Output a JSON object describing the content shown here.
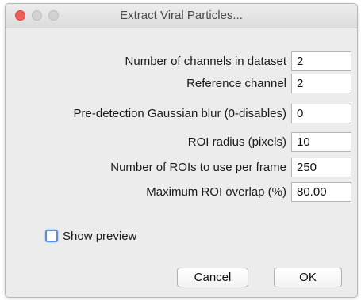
{
  "window": {
    "title": "Extract Viral Particles..."
  },
  "fields": [
    {
      "label": "Number of channels in dataset",
      "value": "2"
    },
    {
      "label": "Reference channel",
      "value": "2"
    },
    {
      "label": "Pre-detection Gaussian blur (0-disables)",
      "value": "0"
    },
    {
      "label": "ROI radius (pixels)",
      "value": "10"
    },
    {
      "label": "Number of ROIs to use per frame",
      "value": "250"
    },
    {
      "label": "Maximum ROI overlap (%)",
      "value": "80.00"
    }
  ],
  "preview": {
    "label": "Show preview",
    "checked": false
  },
  "buttons": {
    "cancel_label": "Cancel",
    "ok_label": "OK"
  },
  "colors": {
    "close_button": "#ef5f55",
    "checkbox_focus": "#5b8fd6"
  }
}
